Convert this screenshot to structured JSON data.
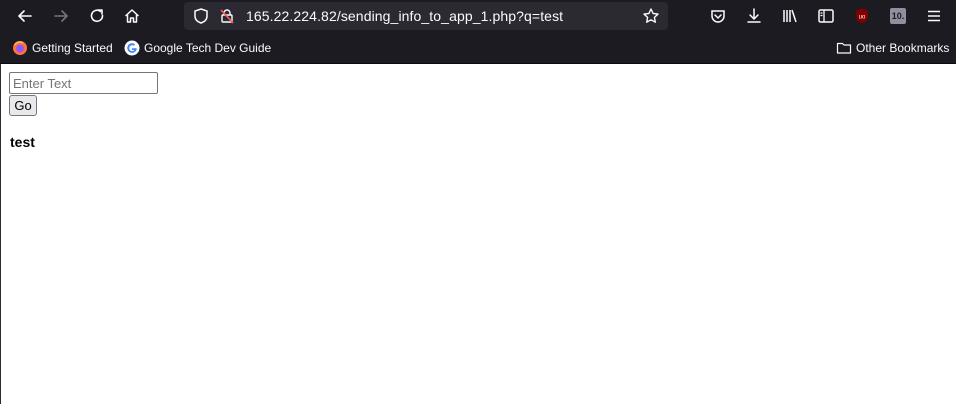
{
  "browser": {
    "url": "165.22.224.82/sending_info_to_app_1.php?q=test",
    "addon_badge_text": "10."
  },
  "bookmarks": {
    "items": [
      {
        "label": "Getting Started",
        "icon": "firefox-icon"
      },
      {
        "label": "Google Tech Dev Guide",
        "icon": "google-icon"
      }
    ],
    "other_label": "Other Bookmarks"
  },
  "page": {
    "input_placeholder": "Enter Text",
    "go_label": "Go",
    "result_text": "test"
  },
  "colors": {
    "toolbar_bg": "#1c1b22",
    "urlbar_bg": "#2b2a33",
    "ublock_red": "#800000"
  }
}
